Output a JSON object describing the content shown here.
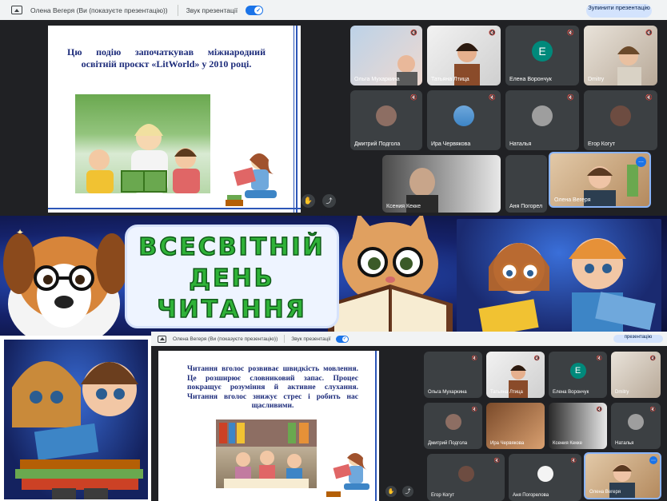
{
  "meet_top": {
    "presenter_label": "Олена Вегеря (Ви (показуєте презентацію))",
    "audio_label": "Звук презентації",
    "stop_button": "Зупинити презентацію",
    "slide_text": "Цю подію започаткував міжнародний освітній проєкт «LitWorld» у 2010 році.",
    "participants": [
      "Ольга Мухаркина",
      "Татьяна Лтица",
      "Елена Ворончук",
      "Dmitry",
      "Дмитрий Подгола",
      "Ира Червякова",
      "Наталья",
      "Егор Когут",
      "Ксения Кекке",
      "Аня Погорел",
      "Олена Вегеря"
    ],
    "avatar_letter": "E"
  },
  "banner": {
    "line1": "ВСЕСВІТНІЙ",
    "line2": "ДЕНЬ",
    "line3": "ЧИТАННЯ"
  },
  "meet_bottom": {
    "presenter_label": "Олена Вегеря (Ви (показуєте презентацію))",
    "audio_label": "Звук презентації",
    "stop_button": "презентацію",
    "slide_text": "Читання вголос розвиває швидкість мовлення. Це розширює словниковий запас. Процес покращує розуміння й активне слухання. Читання вголос знижує стрес і робить нас щасливими.",
    "participants": [
      "Ольга Мухаркина",
      "Татьяна Лтица",
      "Елена Ворончук",
      "Dmitry",
      "Дмитрий Подгола",
      "Ира Червякова",
      "Ксения Кекке",
      "Наталья",
      "Егор Когут",
      "Аня Погорелова",
      "Олена Вегеря"
    ],
    "avatar_letter": "E"
  },
  "colors": {
    "meet_bg": "#202124",
    "tile_bg": "#3c4043",
    "toggle_blue": "#1a73e8",
    "slide_border": "#2c56b8",
    "slide_text": "#1c2b7a",
    "title_green": "#2fb238",
    "avatar_teal": "#00897b"
  }
}
